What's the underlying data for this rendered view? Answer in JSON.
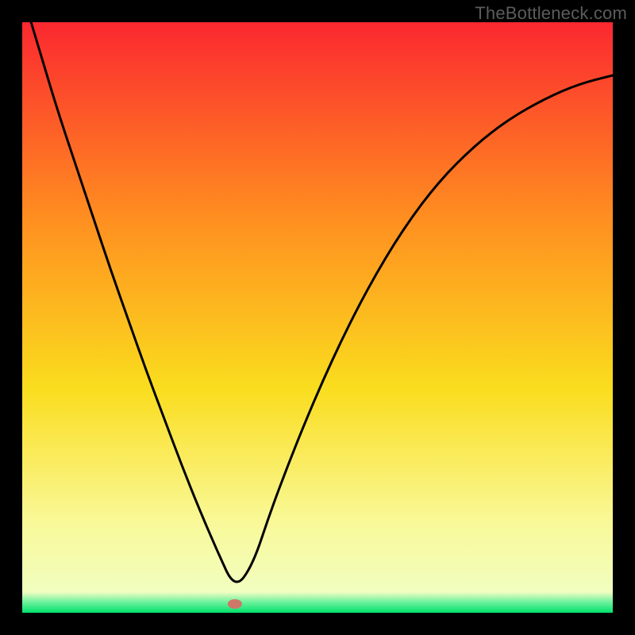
{
  "watermark": "TheBottleneck.com",
  "chart_data": {
    "type": "line",
    "title": "",
    "xlabel": "",
    "ylabel": "",
    "xlim": [
      0,
      100
    ],
    "ylim": [
      0,
      100
    ],
    "x": [
      0,
      3,
      6,
      9,
      12,
      15,
      18,
      21,
      24,
      27,
      30,
      33,
      36,
      39,
      42,
      45,
      48,
      51,
      54,
      57,
      60,
      63,
      66,
      69,
      72,
      75,
      78,
      81,
      84,
      87,
      90,
      93,
      96,
      100
    ],
    "values": [
      105,
      95,
      85,
      76,
      67,
      58,
      49.5,
      41,
      33,
      25,
      17.5,
      10.5,
      4,
      8,
      17,
      25,
      32.5,
      39.5,
      46,
      52,
      57.5,
      62.5,
      67,
      71,
      74.5,
      77.5,
      80.2,
      82.5,
      84.5,
      86.2,
      87.7,
      89,
      90,
      91
    ],
    "marker": {
      "x": 36,
      "y": 1.5,
      "color": "#cf7768"
    },
    "green_band": {
      "y_from": 0,
      "y_to": 4.5
    },
    "yellow_band": {
      "y_from": 4.5,
      "y_to": 16
    }
  },
  "colors": {
    "gradient_top": "#fb2830",
    "gradient_mid_orange": "#ff8e20",
    "gradient_mid_yellow": "#fadd1e",
    "gradient_pale_yellow": "#f9f99a",
    "gradient_green": "#00e16a",
    "curve": "#000000",
    "marker": "#cf7768",
    "frame": "#000000",
    "watermark": "#5c5c5c"
  }
}
